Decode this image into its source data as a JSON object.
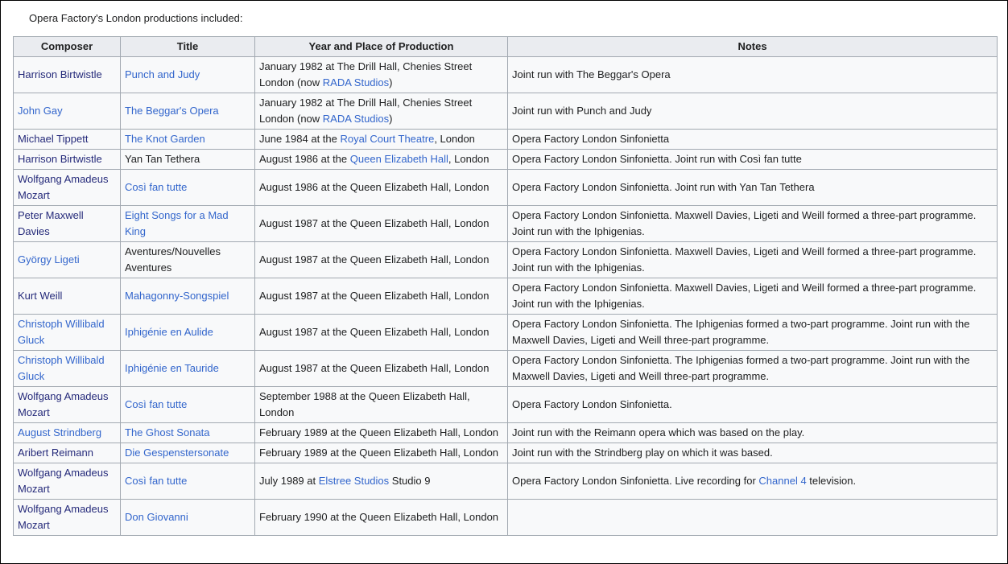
{
  "intro": "Opera Factory's London productions included:",
  "headers": {
    "composer": "Composer",
    "title": "Title",
    "year_place": "Year and Place of Production",
    "notes": "Notes"
  },
  "rows": [
    {
      "composer": "Harrison Birtwistle",
      "title": "Punch and Judy",
      "year_pre": "January 1982 at The Drill Hall, Chenies Street London (now ",
      "year_link": "RADA Studios",
      "year_post": ")",
      "notes_pre": "Joint run with The Beggar's Opera",
      "notes_link": "",
      "notes_post": ""
    },
    {
      "composer": "John Gay",
      "title": "The Beggar's Opera",
      "year_pre": "January 1982 at The Drill Hall, Chenies Street London (now ",
      "year_link": "RADA Studios",
      "year_post": ")",
      "notes_pre": "Joint run with Punch and Judy",
      "notes_link": "",
      "notes_post": ""
    },
    {
      "composer": "Michael Tippett",
      "title": "The Knot Garden",
      "year_pre": "June 1984 at the ",
      "year_link": "Royal Court Theatre",
      "year_post": ", London",
      "notes_pre": "Opera Factory London Sinfonietta",
      "notes_link": "",
      "notes_post": ""
    },
    {
      "composer": "Harrison Birtwistle",
      "title": "Yan Tan Tethera",
      "year_pre": "August 1986 at the ",
      "year_link": "Queen Elizabeth Hall",
      "year_post": ", London",
      "notes_pre": "Opera Factory London Sinfonietta. Joint run with Così fan tutte",
      "notes_link": "",
      "notes_post": ""
    },
    {
      "composer": "Wolfgang Amadeus Mozart",
      "title": "Così fan tutte",
      "year_pre": "August 1986 at the Queen Elizabeth Hall, London",
      "year_link": "",
      "year_post": "",
      "notes_pre": "Opera Factory London Sinfonietta. Joint run with Yan Tan Tethera",
      "notes_link": "",
      "notes_post": ""
    },
    {
      "composer": "Peter Maxwell Davies",
      "title": "Eight Songs for a Mad King",
      "year_pre": "August 1987 at the Queen Elizabeth Hall, London",
      "year_link": "",
      "year_post": "",
      "notes_pre": "Opera Factory London Sinfonietta. Maxwell Davies, Ligeti and Weill formed a three-part programme. Joint run with the Iphigenias.",
      "notes_link": "",
      "notes_post": ""
    },
    {
      "composer": "György Ligeti",
      "title": "Aventures/Nouvelles Aventures",
      "year_pre": "August 1987 at the Queen Elizabeth Hall, London",
      "year_link": "",
      "year_post": "",
      "notes_pre": "Opera Factory London Sinfonietta. Maxwell Davies, Ligeti and Weill formed a three-part programme. Joint run with the Iphigenias.",
      "notes_link": "",
      "notes_post": ""
    },
    {
      "composer": "Kurt Weill",
      "title": "Mahagonny-Songspiel",
      "year_pre": "August 1987 at the Queen Elizabeth Hall, London",
      "year_link": "",
      "year_post": "",
      "notes_pre": "Opera Factory London Sinfonietta. Maxwell Davies, Ligeti and Weill formed a three-part programme. Joint run with the Iphigenias.",
      "notes_link": "",
      "notes_post": ""
    },
    {
      "composer": "Christoph Willibald Gluck",
      "title": "Iphigénie en Aulide",
      "year_pre": "August 1987 at the Queen Elizabeth Hall, London",
      "year_link": "",
      "year_post": "",
      "notes_pre": "Opera Factory London Sinfonietta. The Iphigenias formed a two-part programme. Joint run with the Maxwell Davies, Ligeti and Weill three-part programme.",
      "notes_link": "",
      "notes_post": ""
    },
    {
      "composer": "Christoph Willibald Gluck",
      "title": "Iphigénie en Tauride",
      "year_pre": "August 1987 at the Queen Elizabeth Hall, London",
      "year_link": "",
      "year_post": "",
      "notes_pre": "Opera Factory London Sinfonietta. The Iphigenias formed a two-part programme. Joint run with the Maxwell Davies, Ligeti and Weill three-part programme.",
      "notes_link": "",
      "notes_post": ""
    },
    {
      "composer": "Wolfgang Amadeus Mozart",
      "title": "Così fan tutte",
      "year_pre": "September 1988 at the Queen Elizabeth Hall, London",
      "year_link": "",
      "year_post": "",
      "notes_pre": "Opera Factory London Sinfonietta.",
      "notes_link": "",
      "notes_post": ""
    },
    {
      "composer": "August Strindberg",
      "title": "The Ghost Sonata",
      "year_pre": "February 1989 at the Queen Elizabeth Hall, London",
      "year_link": "",
      "year_post": "",
      "notes_pre": "Joint run with the Reimann opera which was based on the play.",
      "notes_link": "",
      "notes_post": ""
    },
    {
      "composer": "Aribert Reimann",
      "title": "Die Gespenstersonate",
      "year_pre": "February 1989 at the Queen Elizabeth Hall, London",
      "year_link": "",
      "year_post": "",
      "notes_pre": "Joint run with the Strindberg play on which it was based.",
      "notes_link": "",
      "notes_post": ""
    },
    {
      "composer": "Wolfgang Amadeus Mozart",
      "title": "Così fan tutte",
      "year_pre": "July 1989 at ",
      "year_link": "Elstree Studios",
      "year_post": " Studio 9",
      "notes_pre": "Opera Factory London Sinfonietta. Live recording for ",
      "notes_link": "Channel 4",
      "notes_post": " television."
    },
    {
      "composer": "Wolfgang Amadeus Mozart",
      "title": "Don Giovanni",
      "year_pre": "February 1990 at the Queen Elizabeth Hall, London",
      "year_link": "",
      "year_post": "",
      "notes_pre": "",
      "notes_link": "",
      "notes_post": ""
    }
  ],
  "styles": {
    "composer_visited": [
      true,
      false,
      true,
      true,
      true,
      true,
      false,
      true,
      false,
      false,
      true,
      false,
      true,
      true,
      true
    ],
    "title_link": [
      true,
      true,
      true,
      false,
      true,
      true,
      false,
      true,
      true,
      true,
      true,
      true,
      true,
      true,
      true
    ]
  },
  "colors": {
    "link": "#3366cc",
    "link_visited": "#252a7a",
    "border": "#a2a9b1",
    "header_bg": "#eaecf0",
    "cell_bg": "#f8f9fa"
  }
}
